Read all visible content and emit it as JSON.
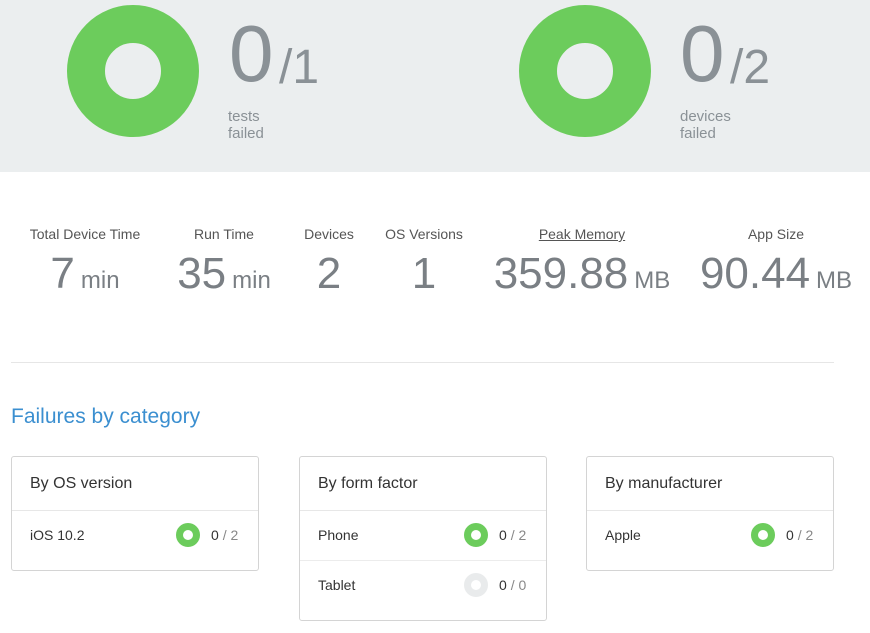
{
  "summary": {
    "tests": {
      "failed": "0",
      "total": "/1",
      "label": "tests failed"
    },
    "devices": {
      "failed": "0",
      "total": "/2",
      "label": "devices failed"
    }
  },
  "metrics": {
    "total_device_time": {
      "label": "Total Device Time",
      "value": "7",
      "unit": "min"
    },
    "run_time": {
      "label": "Run Time",
      "value": "35",
      "unit": "min"
    },
    "devices": {
      "label": "Devices",
      "value": "2"
    },
    "os_versions": {
      "label": "OS Versions",
      "value": "1"
    },
    "peak_memory": {
      "label": "Peak Memory",
      "value": "359.88",
      "unit": "MB"
    },
    "app_size": {
      "label": "App Size",
      "value": "90.44",
      "unit": "MB"
    }
  },
  "failures": {
    "title": "Failures by category",
    "os_version": {
      "title": "By OS version",
      "rows": [
        {
          "name": "iOS 10.2",
          "failed": "0",
          "total": "/ 2",
          "status": "green"
        }
      ]
    },
    "form_factor": {
      "title": "By form factor",
      "rows": [
        {
          "name": "Phone",
          "failed": "0",
          "total": "/ 2",
          "status": "green"
        },
        {
          "name": "Tablet",
          "failed": "0",
          "total": "/ 0",
          "status": "grey"
        }
      ]
    },
    "manufacturer": {
      "title": "By manufacturer",
      "rows": [
        {
          "name": "Apple",
          "failed": "0",
          "total": "/ 2",
          "status": "green"
        }
      ]
    }
  },
  "colors": {
    "pass_green": "#6ccc5c",
    "empty_grey": "#e9ebec",
    "link_blue": "#3b8fd0"
  }
}
